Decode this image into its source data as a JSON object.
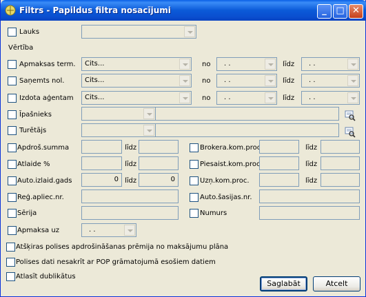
{
  "window": {
    "title": "Filtrs - Papildus filtra nosacījumi",
    "minimize": "_",
    "maximize": "□",
    "close": "✕"
  },
  "labels": {
    "lauks": "Lauks",
    "vertiba": "Vērtība",
    "apmaksas_term": "Apmaksas term.",
    "sanemts_nol": "Saņemts nol.",
    "izdota_agentam": "Izdota aģentam",
    "ipasnieks": "Īpašnieks",
    "turetajs": "Turētājs",
    "apdros_summa": "Apdroš.summa",
    "atlaide": "Atlaide %",
    "auto_izlaid_gads": "Auto.izlaid.gads",
    "reg_apliec_nr": "Reģ.apliec.nr.",
    "serija": "Sērija",
    "apmaksa_uz": "Apmaksa uz",
    "brokera_kom_proc": "Brokera.kom.proc.",
    "piesaist_kom_proc": "Piesaist.kom.proc.",
    "uzn_kom_proc": "Uzņ.kom.proc.",
    "auto_sasijas_nr": "Auto.šasijas.nr.",
    "numurs": "Numurs",
    "no": "no",
    "lidz": "līdz",
    "atskiras": "Atšķiras polises apdrošināšanas prēmija no maksājumu plāna",
    "polises_dati": "Polises dati nesakrīt ar POP grāmatojumā esošiem datiem",
    "atlasit_dublikatus": "Atlasīt dublikātus"
  },
  "values": {
    "apmaksas_type": "Cits...",
    "sanemts_type": "Cits...",
    "izdota_type": "Cits...",
    "date_empty": ". .",
    "auto_gads_from": "0",
    "auto_gads_to": "0"
  },
  "buttons": {
    "save": "Saglabāt",
    "cancel": "Atcelt"
  },
  "colors": {
    "window_bg": "#ece9d8",
    "titlebar": "#0a5fe6",
    "field_border": "#7f9db9"
  }
}
